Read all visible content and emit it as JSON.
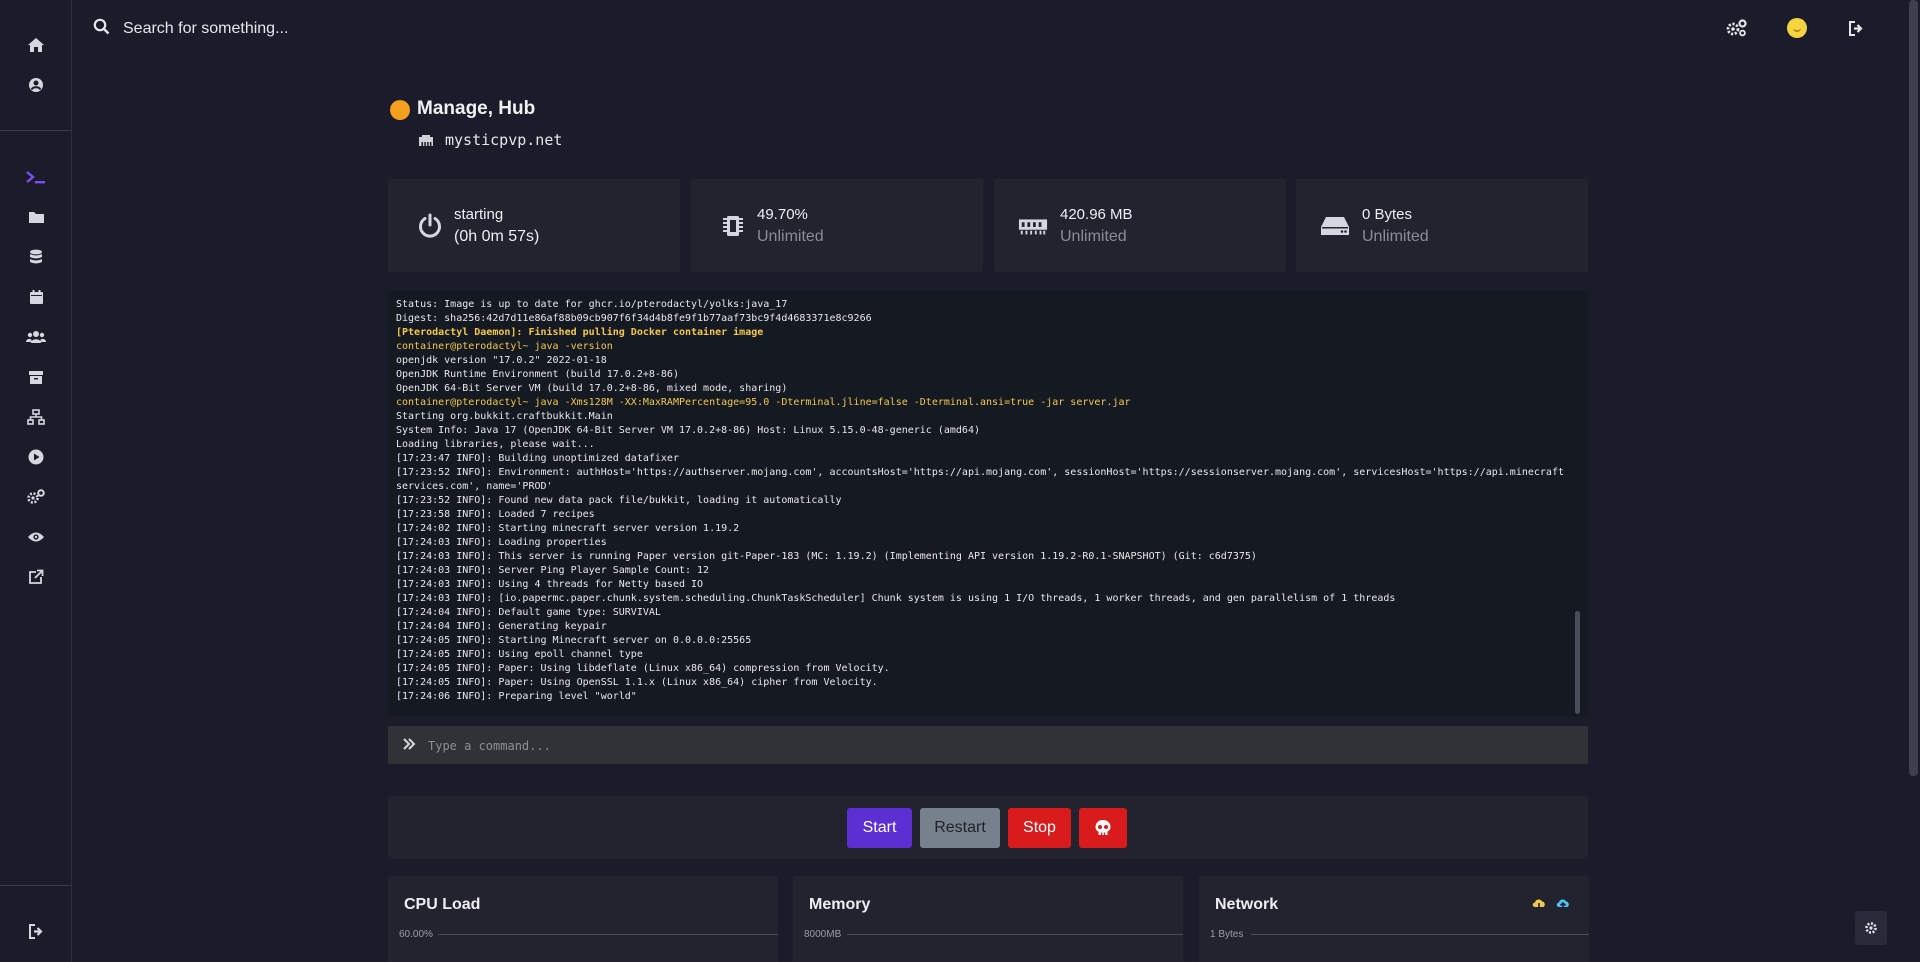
{
  "search": {
    "placeholder": "Search for something..."
  },
  "server": {
    "name": "Manage, Hub",
    "host": "mysticpvp.net",
    "status_color": "#f4a01c"
  },
  "stats": [
    {
      "main": "starting",
      "main2": "(0h 0m 57s)",
      "icon": "power-icon"
    },
    {
      "main": "49.70%",
      "sub": "Unlimited",
      "icon": "cpu-icon"
    },
    {
      "main": "420.96 MB",
      "sub": "Unlimited",
      "icon": "memory-icon"
    },
    {
      "main": "0 Bytes",
      "sub": "Unlimited",
      "icon": "disk-icon"
    }
  ],
  "console": {
    "lines": [
      "Status: Image is up to date for ghcr.io/pterodactyl/yolks:java_17",
      "Digest: sha256:42d7d11e86af88b09cb907f6f34d4b8fe9f1b77aaf73bc9f4d4683371e8c9266",
      "[Pterodactyl Daemon]: Finished pulling Docker container image",
      "container@pterodactyl~ java -version",
      "openjdk version \"17.0.2\" 2022-01-18",
      "OpenJDK Runtime Environment (build 17.0.2+8-86)",
      "OpenJDK 64-Bit Server VM (build 17.0.2+8-86, mixed mode, sharing)",
      "container@pterodactyl~ java -Xms128M -XX:MaxRAMPercentage=95.0 -Dterminal.jline=false -Dterminal.ansi=true -jar server.jar",
      "Starting org.bukkit.craftbukkit.Main",
      "System Info: Java 17 (OpenJDK 64-Bit Server VM 17.0.2+8-86) Host: Linux 5.15.0-48-generic (amd64)",
      "Loading libraries, please wait...",
      "[17:23:47 INFO]: Building unoptimized datafixer",
      "[17:23:52 INFO]: Environment: authHost='https://authserver.mojang.com', accountsHost='https://api.mojang.com', sessionHost='https://sessionserver.mojang.com', servicesHost='https://api.minecraft",
      "services.com', name='PROD'",
      "[17:23:52 INFO]: Found new data pack file/bukkit, loading it automatically",
      "[17:23:58 INFO]: Loaded 7 recipes",
      "[17:24:02 INFO]: Starting minecraft server version 1.19.2",
      "[17:24:03 INFO]: Loading properties",
      "[17:24:03 INFO]: This server is running Paper version git-Paper-183 (MC: 1.19.2) (Implementing API version 1.19.2-R0.1-SNAPSHOT) (Git: c6d7375)",
      "[17:24:03 INFO]: Server Ping Player Sample Count: 12",
      "[17:24:03 INFO]: Using 4 threads for Netty based IO",
      "[17:24:03 INFO]: [io.papermc.paper.chunk.system.scheduling.ChunkTaskScheduler] Chunk system is using 1 I/O threads, 1 worker threads, and gen parallelism of 1 threads",
      "[17:24:04 INFO]: Default game type: SURVIVAL",
      "[17:24:04 INFO]: Generating keypair",
      "[17:24:05 INFO]: Starting Minecraft server on 0.0.0.0:25565",
      "[17:24:05 INFO]: Using epoll channel type",
      "[17:24:05 INFO]: Paper: Using libdeflate (Linux x86_64) compression from Velocity.",
      "[17:24:05 INFO]: Paper: Using OpenSSL 1.1.x (Linux x86_64) cipher from Velocity.",
      "[17:24:06 INFO]: Preparing level \"world\""
    ],
    "command_placeholder": "Type a command..."
  },
  "buttons": {
    "start": "Start",
    "restart": "Restart",
    "stop": "Stop"
  },
  "graphs": {
    "cpu": {
      "title": "CPU Load",
      "ylabel": "60.00%"
    },
    "memory": {
      "title": "Memory",
      "ylabel": "8000MB"
    },
    "network": {
      "title": "Network",
      "ylabel": "1 Bytes"
    }
  },
  "colors": {
    "accent": "#7c4dff",
    "start": "#5b2fd1",
    "stop": "#d81b1b",
    "restart": "#77808d",
    "console_prompt": "#f2c94c"
  }
}
